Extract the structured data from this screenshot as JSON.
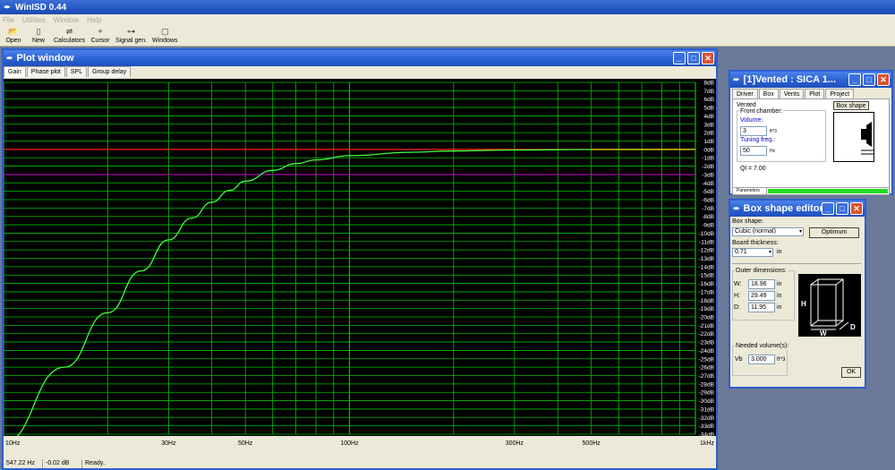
{
  "app": {
    "title": "WinISD 0.44",
    "menu": [
      "File",
      "Utilities",
      "Window",
      "Help"
    ],
    "toolbar": [
      "Open",
      "New",
      "Calculators",
      "Cursor",
      "Signal gen.",
      "Windows"
    ]
  },
  "plot_window": {
    "title": "Plot window",
    "tabs": [
      "Gain",
      "Phase plot",
      "SPL",
      "Group delay"
    ],
    "active_tab": "Gain",
    "status": {
      "frequency": "547.22 Hz",
      "level": "-0.02 dB",
      "message": "Ready.."
    }
  },
  "chart_data": {
    "type": "line",
    "x_scale": "log",
    "xlim": [
      10,
      1000
    ],
    "ylim": [
      -35,
      8
    ],
    "x_ticks": [
      {
        "value": 10,
        "label": "10Hz"
      },
      {
        "value": 30,
        "label": "30Hz"
      },
      {
        "value": 50,
        "label": "50Hz"
      },
      {
        "value": 100,
        "label": "100Hz"
      },
      {
        "value": 300,
        "label": "300Hz"
      },
      {
        "value": 500,
        "label": "500Hz"
      },
      {
        "value": 1000,
        "label": "1kHz"
      }
    ],
    "y_tick_labels": [
      "8dB",
      "7dB",
      "6dB",
      "5dB",
      "4dB",
      "3dB",
      "2dB",
      "1dB",
      "0dB",
      "-1dB",
      "-2dB",
      "-3dB",
      "-4dB",
      "-5dB",
      "-6dB",
      "-7dB",
      "-8dB",
      "-9dB",
      "-10dB",
      "-11dB",
      "-12dB",
      "-13dB",
      "-14dB",
      "-15dB",
      "-16dB",
      "-17dB",
      "-18dB",
      "-19dB",
      "-20dB",
      "-21dB",
      "-22dB",
      "-23dB",
      "-24dB",
      "-25dB",
      "-26dB",
      "-27dB",
      "-28dB",
      "-29dB",
      "-30dB",
      "-31dB",
      "-32dB",
      "-33dB",
      "-34dB"
    ],
    "reference_lines": [
      {
        "value": 0,
        "color": "#ff2020"
      },
      {
        "value": -3,
        "color": "#c000c0"
      }
    ],
    "series": [
      {
        "color": "#40ff40",
        "x": [
          10,
          15,
          20,
          25,
          30,
          35,
          40,
          45,
          50,
          60,
          70,
          80,
          100,
          150,
          200,
          300,
          500,
          1000
        ],
        "y": [
          -35,
          -26,
          -19.5,
          -14.5,
          -10.8,
          -8.2,
          -6.3,
          -4.9,
          -3.8,
          -2.5,
          -1.7,
          -1.25,
          -0.75,
          -0.35,
          -0.2,
          -0.08,
          -0.02,
          0
        ]
      },
      {
        "color": "#d8c000",
        "x": [
          500,
          700,
          1000
        ],
        "y": [
          -0.02,
          -0.01,
          0
        ]
      }
    ],
    "grid": true,
    "background": "#000000",
    "grid_color": "#00c000"
  },
  "vented_window": {
    "title": "[1]Vented : SICA 1...",
    "tabs": [
      "Driver",
      "Box",
      "Vents",
      "Plot",
      "Project"
    ],
    "active_tab": "Box",
    "box_type": "Vented",
    "box_shape_button": "Box shape",
    "front_chamber_label": "Front chamber:",
    "volume_label": "Volume:",
    "volume_value": "3",
    "volume_unit": "ft^3",
    "tuning_label": "Tuning freq.:",
    "tuning_value": "50",
    "tuning_unit": "Hz",
    "ql": "Ql = 7.00",
    "parameters_label": "Parameters"
  },
  "box_shape_editor": {
    "title": "Box shape editor",
    "box_shape_label": "Box shape:",
    "box_shape_value": "Cubic (normal)",
    "optimum_button": "Optimum",
    "board_thickness_label": "Board thickness:",
    "board_thickness_value": "0.71",
    "board_thickness_unit": "in",
    "outer_dimensions_label": "Outer dimensions:",
    "w_label": "W:",
    "w_value": "18.96",
    "h_label": "H:",
    "h_value": "29.49",
    "d_label": "D:",
    "d_value": "11.95",
    "dim_unit": "in",
    "needed_volume_label": "Needed volume(s):",
    "vb_label": "Vb",
    "vb_value": "3.000",
    "vb_unit": "ft^3",
    "ok_button": "OK",
    "diagram_labels": {
      "h": "H",
      "w": "W",
      "d": "D"
    }
  }
}
